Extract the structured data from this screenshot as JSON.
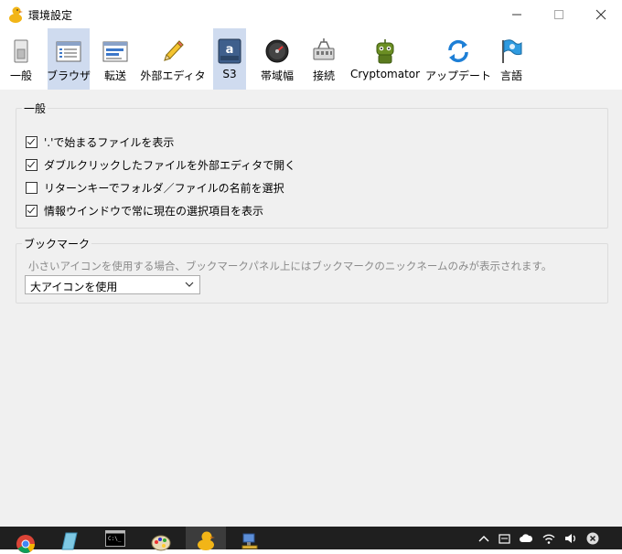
{
  "window": {
    "title": "環境設定"
  },
  "toolbar": [
    {
      "name": "toolbar-general",
      "label": "一般",
      "icon": "switch-icon",
      "selected": false
    },
    {
      "name": "toolbar-browser",
      "label": "ブラウザ",
      "icon": "browser-window-icon",
      "selected": true
    },
    {
      "name": "toolbar-transfer",
      "label": "転送",
      "icon": "transfer-window-icon",
      "selected": false
    },
    {
      "name": "toolbar-editor",
      "label": "外部エディタ",
      "icon": "pencil-icon",
      "selected": false
    },
    {
      "name": "toolbar-s3",
      "label": "S3",
      "icon": "amazon-s3-icon",
      "selected": true
    },
    {
      "name": "toolbar-bandwidth",
      "label": "帯域幅",
      "icon": "gauge-icon",
      "selected": false
    },
    {
      "name": "toolbar-connection",
      "label": "接続",
      "icon": "network-connection-icon",
      "selected": false
    },
    {
      "name": "toolbar-cryptomator",
      "label": "Cryptomator",
      "icon": "cryptomator-robot-icon",
      "selected": false
    },
    {
      "name": "toolbar-update",
      "label": "アップデート",
      "icon": "refresh-arrows-icon",
      "selected": false
    },
    {
      "name": "toolbar-language",
      "label": "言語",
      "icon": "flag-icon",
      "selected": false
    }
  ],
  "general_group": {
    "title": "一般",
    "options": [
      {
        "label": "'.'で始まるファイルを表示",
        "checked": true
      },
      {
        "label": "ダブルクリックしたファイルを外部エディタで開く",
        "checked": true
      },
      {
        "label": "リターンキーでフォルダ／ファイルの名前を選択",
        "checked": false
      },
      {
        "label": "情報ウインドウで常に現在の選択項目を表示",
        "checked": true
      }
    ]
  },
  "bookmark_group": {
    "title": "ブックマーク",
    "hint": "小さいアイコンを使用する場合、ブックマークパネル上にはブックマークのニックネームのみが表示されます。",
    "select_value": "大アイコンを使用"
  },
  "taskbar": {
    "apps": [
      "chrome-icon",
      "notepad-icon",
      "terminal-icon",
      "paint-icon",
      "cyberduck-icon",
      "network-app-icon"
    ],
    "tray": [
      "chevron-up-icon",
      "keyboard-icon",
      "cloud-icon",
      "wifi-icon",
      "volume-icon",
      "close-circle-icon"
    ]
  }
}
